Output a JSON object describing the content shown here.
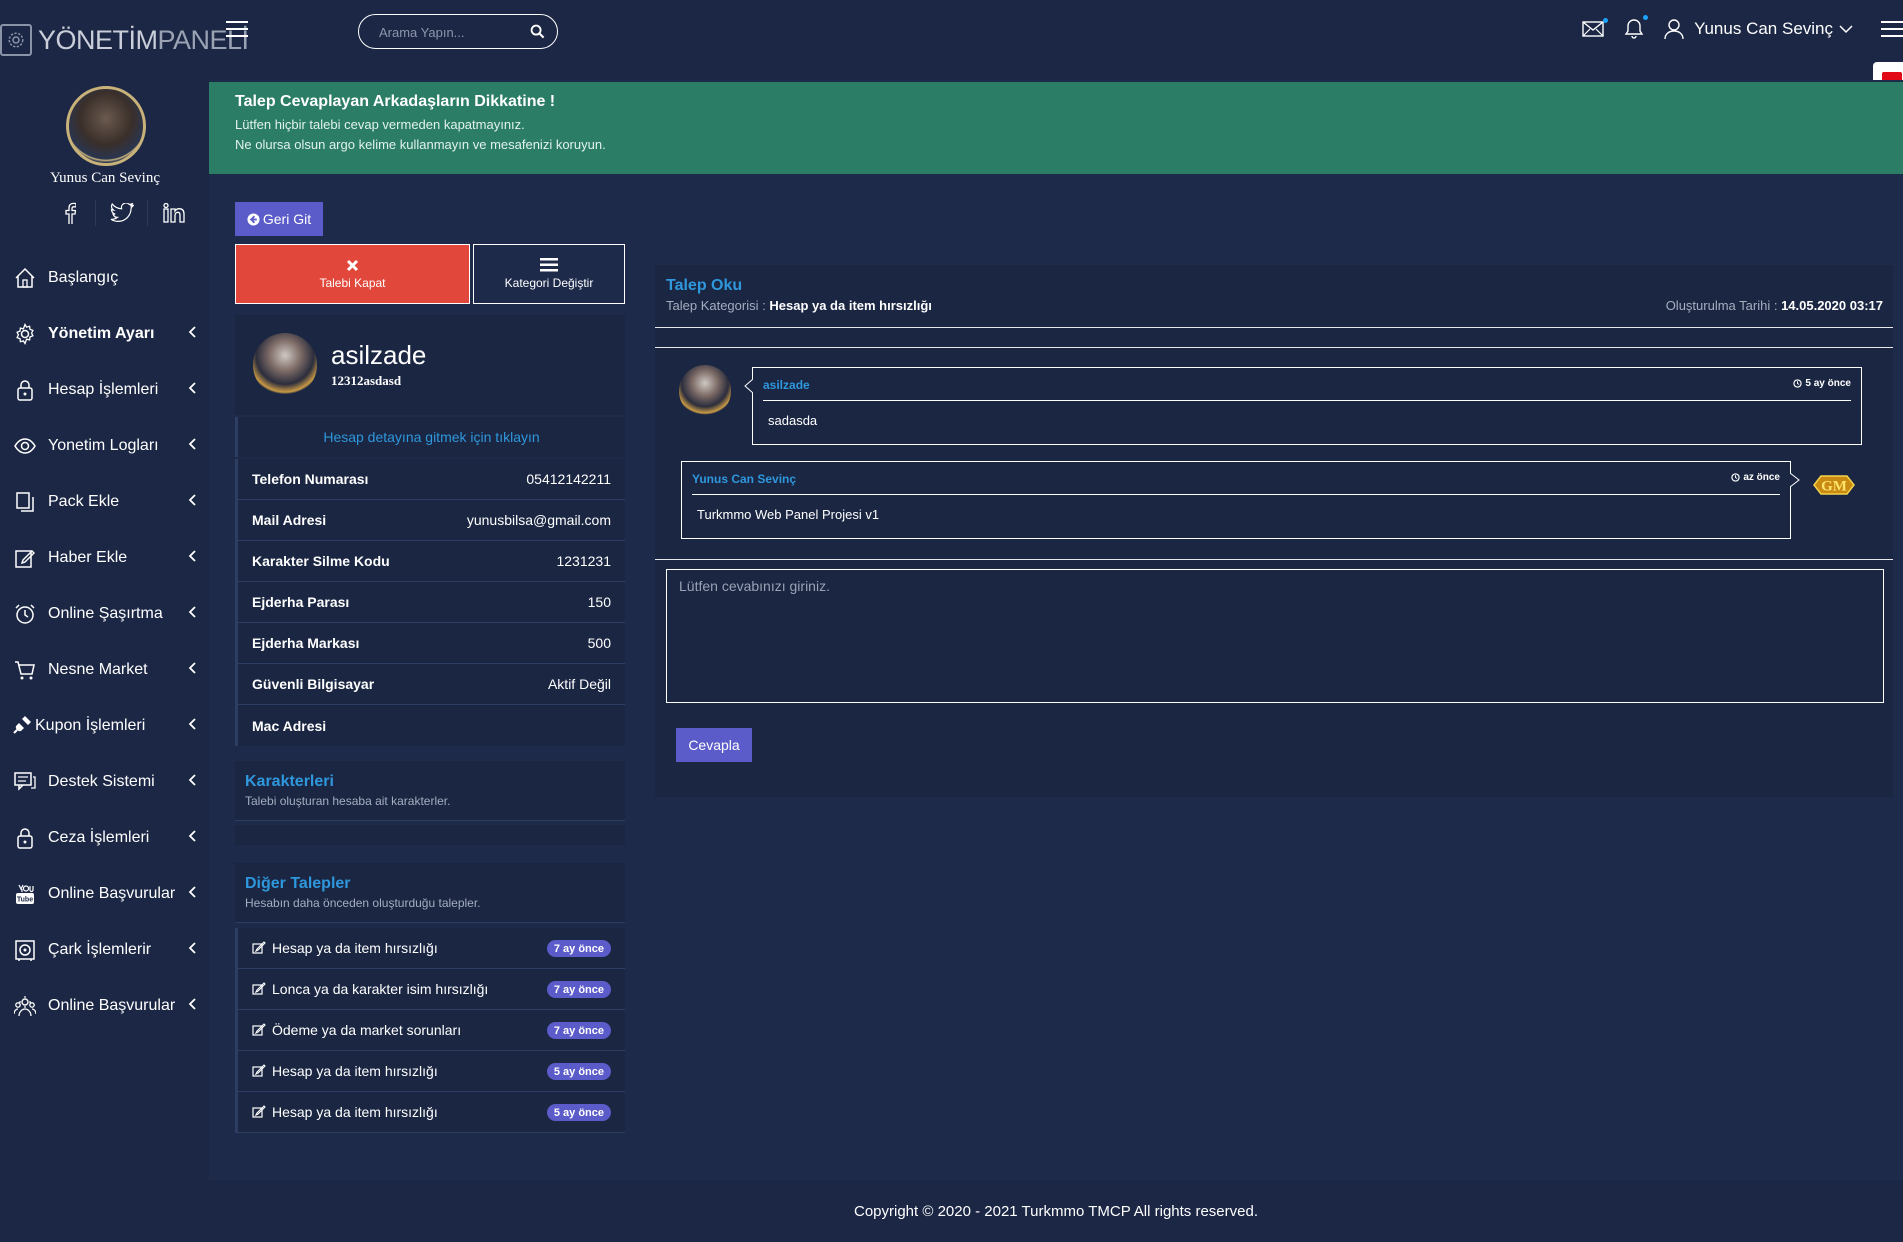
{
  "header": {
    "logo_strong": "YÖNETİM",
    "logo_light": "PANELİ",
    "search_placeholder": "Arama Yapın...",
    "user_name": "Yunus Can Sevinç"
  },
  "sidebar": {
    "user_name": "Yunus Can Sevinç",
    "items": [
      {
        "label": "Başlangıç",
        "icon": "home-icon"
      },
      {
        "label": "Yönetim Ayarı",
        "icon": "gear-icon"
      },
      {
        "label": "Hesap İşlemleri",
        "icon": "lock-icon"
      },
      {
        "label": "Yonetim Logları",
        "icon": "eye-icon"
      },
      {
        "label": "Pack Ekle",
        "icon": "copy-icon"
      },
      {
        "label": "Haber Ekle",
        "icon": "edit-icon"
      },
      {
        "label": "Online Şaşırtma",
        "icon": "alarm-icon"
      },
      {
        "label": "Nesne Market",
        "icon": "cart-icon"
      },
      {
        "label": "Kupon İşlemleri",
        "icon": "plug-icon"
      },
      {
        "label": "Destek Sistemi",
        "icon": "chat-icon"
      },
      {
        "label": "Ceza İşlemleri",
        "icon": "lock-icon"
      },
      {
        "label": "Online Başvurular",
        "icon": "youtube-icon"
      },
      {
        "label": "Çark İşlemlerir",
        "icon": "safe-icon"
      },
      {
        "label": "Online Başvurular",
        "icon": "users-gear-icon"
      }
    ]
  },
  "alert": {
    "title": "Talep Cevaplayan Arkadaşların Dikkatine !",
    "line1": "Lütfen hiçbir talebi cevap vermeden kapatmayınız.",
    "line2": "Ne olursa olsun argo kelime kullanmayın ve mesafenizi koruyun."
  },
  "buttons": {
    "back": "Geri Git",
    "close": "Talebi Kapat",
    "category": "Kategori Değiştir",
    "reply": "Cevapla"
  },
  "profile": {
    "name": "asilzade",
    "sub": "12312asdasd",
    "detail_link": "Hesap detayına gitmek için tıklayın",
    "rows": [
      {
        "key": "Telefon Numarası",
        "value": "05412142211"
      },
      {
        "key": "Mail Adresi",
        "value": "yunusbilsa@gmail.com"
      },
      {
        "key": "Karakter Silme Kodu",
        "value": "1231231"
      },
      {
        "key": "Ejderha Parası",
        "value": "150"
      },
      {
        "key": "Ejderha Markası",
        "value": "500"
      },
      {
        "key": "Güvenli Bilgisayar",
        "value": "Aktif Değil"
      },
      {
        "key": "Mac Adresi",
        "value": ""
      }
    ]
  },
  "characters": {
    "title": "Karakterleri",
    "desc": "Talebi oluşturan hesaba ait karakterler."
  },
  "other_tickets": {
    "title": "Diğer Talepler",
    "desc": "Hesabın daha önceden oluşturduğu talepler.",
    "items": [
      {
        "label": "Hesap ya da item hırsızlığı",
        "badge": "7 ay önce"
      },
      {
        "label": "Lonca ya da karakter isim hırsızlığı",
        "badge": "7 ay önce"
      },
      {
        "label": "Ödeme ya da market sorunları",
        "badge": "7 ay önce"
      },
      {
        "label": "Hesap ya da item hırsızlığı",
        "badge": "5 ay önce"
      },
      {
        "label": "Hesap ya da item hırsızlığı",
        "badge": "5 ay önce"
      }
    ]
  },
  "ticket": {
    "title": "Talep Oku",
    "category_label": "Talep Kategorisi :",
    "category_value": "Hesap ya da item hırsızlığı",
    "date_label": "Oluşturulma Tarihi :",
    "date_value": "14.05.2020 03:17",
    "messages": [
      {
        "author": "asilzade",
        "time": "5 ay önce",
        "text": "sadasda"
      },
      {
        "author": "Yunus Can Sevinç",
        "time": "az önce",
        "text": "Turkmmo Web Panel Projesi v1"
      }
    ],
    "gm_badge": "GM",
    "reply_placeholder": "Lütfen cevabınızı giriniz."
  },
  "footer": {
    "text": "Copyright © 2020 - 2021 Turkmmo TMCP All rights reserved."
  },
  "colors": {
    "background": "#1b2744",
    "panel": "#1a2642",
    "alert": "#2b7d66",
    "accent_blue": "#2f97dc",
    "button_purple": "#5b5bc9",
    "danger": "#e1483b"
  }
}
